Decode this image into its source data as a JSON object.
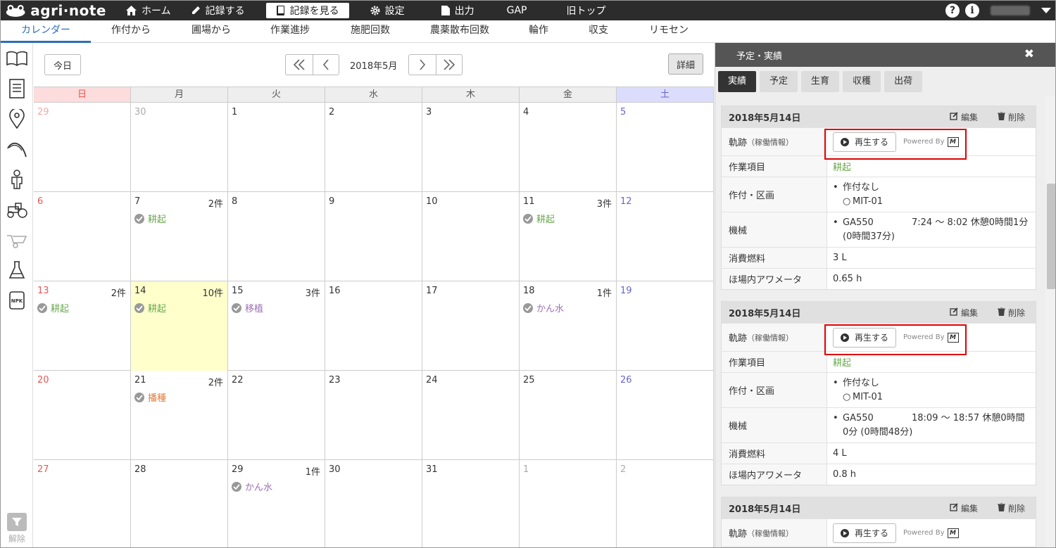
{
  "app": {
    "logo": "agri·note"
  },
  "nav": {
    "home": "ホーム",
    "record": "記録する",
    "view": "記録を見る",
    "settings": "設定",
    "output": "出力",
    "gap": "GAP",
    "old_top": "旧トップ"
  },
  "topright": {
    "help": "?",
    "info": "i"
  },
  "subtabs": [
    "カレンダー",
    "作付から",
    "圃場から",
    "作業進捗",
    "施肥回数",
    "農薬散布回数",
    "輪作",
    "収支",
    "リモセン"
  ],
  "sidebar": {
    "filter_label": "解除"
  },
  "calendar": {
    "today_btn": "今日",
    "month": "2018年5月",
    "detail_btn": "詳細",
    "dows": [
      "日",
      "月",
      "火",
      "水",
      "木",
      "金",
      "土"
    ],
    "weeks": [
      [
        {
          "d": "29",
          "o": true
        },
        {
          "d": "30",
          "o": true
        },
        {
          "d": "1"
        },
        {
          "d": "2"
        },
        {
          "d": "3"
        },
        {
          "d": "4"
        },
        {
          "d": "5"
        }
      ],
      [
        {
          "d": "6"
        },
        {
          "d": "7",
          "c": "2件",
          "e": "耕起",
          "ec": "#6aa84f"
        },
        {
          "d": "8"
        },
        {
          "d": "9"
        },
        {
          "d": "10"
        },
        {
          "d": "11",
          "c": "3件",
          "e": "耕起",
          "ec": "#6aa84f"
        },
        {
          "d": "12"
        }
      ],
      [
        {
          "d": "13",
          "c": "2件",
          "e": "耕起",
          "ec": "#6aa84f"
        },
        {
          "d": "14",
          "c": "10件",
          "e": "耕起",
          "ec": "#6aa84f",
          "t": true
        },
        {
          "d": "15",
          "c": "3件",
          "e": "移植",
          "ec": "#9b6fb3"
        },
        {
          "d": "16"
        },
        {
          "d": "17"
        },
        {
          "d": "18",
          "c": "1件",
          "e": "かん水",
          "ec": "#9b6fb3"
        },
        {
          "d": "19"
        }
      ],
      [
        {
          "d": "20"
        },
        {
          "d": "21",
          "c": "2件",
          "e": "播種",
          "ec": "#e07b39"
        },
        {
          "d": "22"
        },
        {
          "d": "23"
        },
        {
          "d": "24"
        },
        {
          "d": "25"
        },
        {
          "d": "26"
        }
      ],
      [
        {
          "d": "27"
        },
        {
          "d": "28"
        },
        {
          "d": "29",
          "c": "1件",
          "e": "かん水",
          "ec": "#9b6fb3"
        },
        {
          "d": "30"
        },
        {
          "d": "31"
        },
        {
          "d": "1",
          "o": true
        },
        {
          "d": "2",
          "o": true
        }
      ]
    ]
  },
  "panel": {
    "title": "予定・実績",
    "close": "✖",
    "tabs": [
      "実績",
      "予定",
      "生育",
      "収穫",
      "出荷"
    ],
    "edit": "編集",
    "delete": "削除",
    "labels": {
      "track": "軌跡",
      "track_sub": "（稼働情報）",
      "work": "作業項目",
      "crop": "作付・区画",
      "machine": "機械",
      "fuel": "消費燃料",
      "meter": "ほ場内アワメータ"
    },
    "play": "再生する",
    "powered": "Powered By",
    "mlogo": "M",
    "records": [
      {
        "date": "2018年5月14日",
        "work": "耕起",
        "crop": "作付なし",
        "plot": "MIT-01",
        "machine": "GA550",
        "time": "7:24 〜 8:02 休憩0時間1分 (0時間37分)",
        "fuel": "3 L",
        "meter": "0.65 h"
      },
      {
        "date": "2018年5月14日",
        "work": "耕起",
        "crop": "作付なし",
        "plot": "MIT-01",
        "machine": "GA550",
        "time": "18:09 〜 18:57 休憩0時間0分 (0時間48分)",
        "fuel": "4 L",
        "meter": "0.8 h"
      },
      {
        "date": "2018年5月14日"
      }
    ]
  }
}
